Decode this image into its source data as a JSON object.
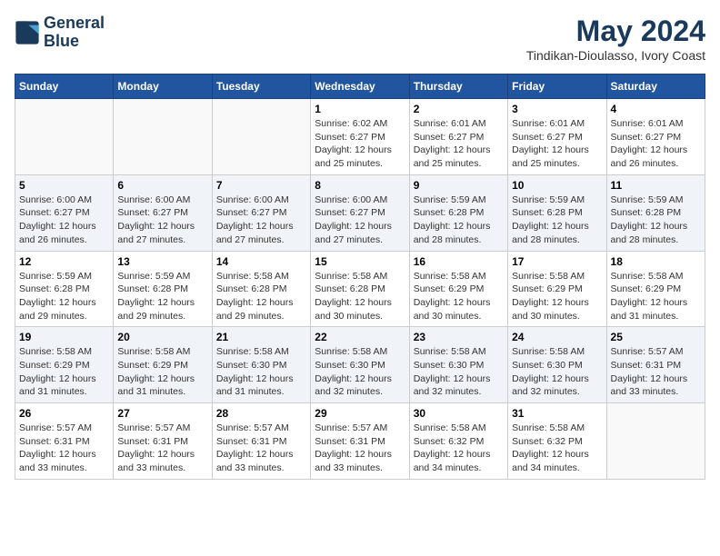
{
  "header": {
    "logo_line1": "General",
    "logo_line2": "Blue",
    "month_year": "May 2024",
    "location": "Tindikan-Dioulasso, Ivory Coast"
  },
  "days_of_week": [
    "Sunday",
    "Monday",
    "Tuesday",
    "Wednesday",
    "Thursday",
    "Friday",
    "Saturday"
  ],
  "weeks": [
    [
      {
        "day": "",
        "info": ""
      },
      {
        "day": "",
        "info": ""
      },
      {
        "day": "",
        "info": ""
      },
      {
        "day": "1",
        "info": "Sunrise: 6:02 AM\nSunset: 6:27 PM\nDaylight: 12 hours\nand 25 minutes."
      },
      {
        "day": "2",
        "info": "Sunrise: 6:01 AM\nSunset: 6:27 PM\nDaylight: 12 hours\nand 25 minutes."
      },
      {
        "day": "3",
        "info": "Sunrise: 6:01 AM\nSunset: 6:27 PM\nDaylight: 12 hours\nand 25 minutes."
      },
      {
        "day": "4",
        "info": "Sunrise: 6:01 AM\nSunset: 6:27 PM\nDaylight: 12 hours\nand 26 minutes."
      }
    ],
    [
      {
        "day": "5",
        "info": "Sunrise: 6:00 AM\nSunset: 6:27 PM\nDaylight: 12 hours\nand 26 minutes."
      },
      {
        "day": "6",
        "info": "Sunrise: 6:00 AM\nSunset: 6:27 PM\nDaylight: 12 hours\nand 27 minutes."
      },
      {
        "day": "7",
        "info": "Sunrise: 6:00 AM\nSunset: 6:27 PM\nDaylight: 12 hours\nand 27 minutes."
      },
      {
        "day": "8",
        "info": "Sunrise: 6:00 AM\nSunset: 6:27 PM\nDaylight: 12 hours\nand 27 minutes."
      },
      {
        "day": "9",
        "info": "Sunrise: 5:59 AM\nSunset: 6:28 PM\nDaylight: 12 hours\nand 28 minutes."
      },
      {
        "day": "10",
        "info": "Sunrise: 5:59 AM\nSunset: 6:28 PM\nDaylight: 12 hours\nand 28 minutes."
      },
      {
        "day": "11",
        "info": "Sunrise: 5:59 AM\nSunset: 6:28 PM\nDaylight: 12 hours\nand 28 minutes."
      }
    ],
    [
      {
        "day": "12",
        "info": "Sunrise: 5:59 AM\nSunset: 6:28 PM\nDaylight: 12 hours\nand 29 minutes."
      },
      {
        "day": "13",
        "info": "Sunrise: 5:59 AM\nSunset: 6:28 PM\nDaylight: 12 hours\nand 29 minutes."
      },
      {
        "day": "14",
        "info": "Sunrise: 5:58 AM\nSunset: 6:28 PM\nDaylight: 12 hours\nand 29 minutes."
      },
      {
        "day": "15",
        "info": "Sunrise: 5:58 AM\nSunset: 6:28 PM\nDaylight: 12 hours\nand 30 minutes."
      },
      {
        "day": "16",
        "info": "Sunrise: 5:58 AM\nSunset: 6:29 PM\nDaylight: 12 hours\nand 30 minutes."
      },
      {
        "day": "17",
        "info": "Sunrise: 5:58 AM\nSunset: 6:29 PM\nDaylight: 12 hours\nand 30 minutes."
      },
      {
        "day": "18",
        "info": "Sunrise: 5:58 AM\nSunset: 6:29 PM\nDaylight: 12 hours\nand 31 minutes."
      }
    ],
    [
      {
        "day": "19",
        "info": "Sunrise: 5:58 AM\nSunset: 6:29 PM\nDaylight: 12 hours\nand 31 minutes."
      },
      {
        "day": "20",
        "info": "Sunrise: 5:58 AM\nSunset: 6:29 PM\nDaylight: 12 hours\nand 31 minutes."
      },
      {
        "day": "21",
        "info": "Sunrise: 5:58 AM\nSunset: 6:30 PM\nDaylight: 12 hours\nand 31 minutes."
      },
      {
        "day": "22",
        "info": "Sunrise: 5:58 AM\nSunset: 6:30 PM\nDaylight: 12 hours\nand 32 minutes."
      },
      {
        "day": "23",
        "info": "Sunrise: 5:58 AM\nSunset: 6:30 PM\nDaylight: 12 hours\nand 32 minutes."
      },
      {
        "day": "24",
        "info": "Sunrise: 5:58 AM\nSunset: 6:30 PM\nDaylight: 12 hours\nand 32 minutes."
      },
      {
        "day": "25",
        "info": "Sunrise: 5:57 AM\nSunset: 6:31 PM\nDaylight: 12 hours\nand 33 minutes."
      }
    ],
    [
      {
        "day": "26",
        "info": "Sunrise: 5:57 AM\nSunset: 6:31 PM\nDaylight: 12 hours\nand 33 minutes."
      },
      {
        "day": "27",
        "info": "Sunrise: 5:57 AM\nSunset: 6:31 PM\nDaylight: 12 hours\nand 33 minutes."
      },
      {
        "day": "28",
        "info": "Sunrise: 5:57 AM\nSunset: 6:31 PM\nDaylight: 12 hours\nand 33 minutes."
      },
      {
        "day": "29",
        "info": "Sunrise: 5:57 AM\nSunset: 6:31 PM\nDaylight: 12 hours\nand 33 minutes."
      },
      {
        "day": "30",
        "info": "Sunrise: 5:58 AM\nSunset: 6:32 PM\nDaylight: 12 hours\nand 34 minutes."
      },
      {
        "day": "31",
        "info": "Sunrise: 5:58 AM\nSunset: 6:32 PM\nDaylight: 12 hours\nand 34 minutes."
      },
      {
        "day": "",
        "info": ""
      }
    ]
  ]
}
